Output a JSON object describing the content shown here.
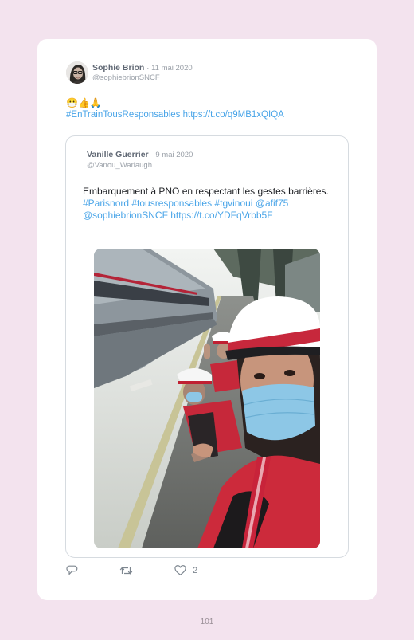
{
  "tweet": {
    "author_name": "Sophie Brion",
    "date": "11 mai 2020",
    "handle": "@sophiebrionSNCF",
    "emojis": "😷👍🙏",
    "hashtag": "#EnTrainTousResponsables",
    "link": "https://t.co/q9MB1xQIQA"
  },
  "quoted": {
    "author_name": "Vanille Guerrier",
    "date": "9 mai 2020",
    "handle": "@Vanou_Warlaugh",
    "text": "Embarquement à PNO en respectant les gestes barrières.",
    "hashtags": "#Parisnord #tousresponsables #tgvinoui",
    "mentions": "@afif75 @sophiebrionSNCF",
    "link": "https://t.co/YDFqVrbb5F"
  },
  "actions": {
    "like_count": "2"
  },
  "icons": {
    "reply": "reply-icon",
    "retweet": "retweet-icon",
    "like": "heart-icon"
  },
  "colors": {
    "page_background": "#f3e3ee",
    "link_blue": "#4aa5e8",
    "secondary_gray": "#9aa0a8"
  },
  "page_number": "101"
}
